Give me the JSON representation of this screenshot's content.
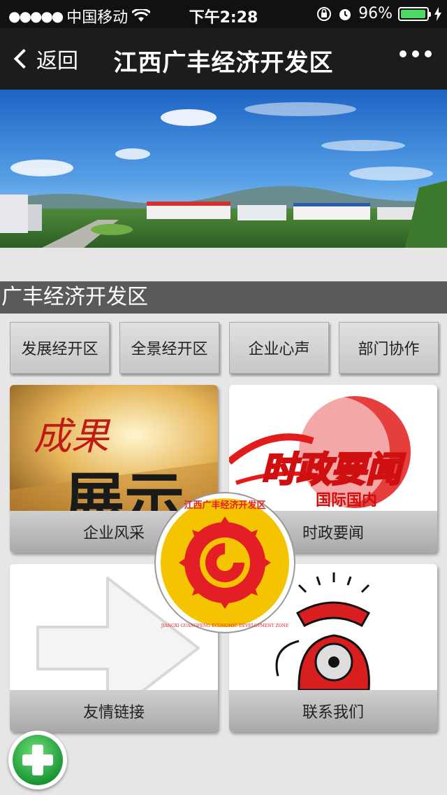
{
  "status_bar": {
    "carrier": "中国移动",
    "time": "下午2:28",
    "battery": "96%",
    "battery_level": 0.96
  },
  "nav": {
    "back_label": "返回",
    "title": "江西广丰经济开发区"
  },
  "section": {
    "title": "广丰经济开发区"
  },
  "tabs": [
    {
      "label": "发展经开区"
    },
    {
      "label": "全景经开区"
    },
    {
      "label": "企业心声"
    },
    {
      "label": "部门协作"
    }
  ],
  "tiles": [
    {
      "label": "企业风采",
      "art_text_1": "成果",
      "art_text_2": "展示"
    },
    {
      "label": "时政要闻",
      "art_text_1": "时政要闻",
      "art_text_2": "国际国内"
    },
    {
      "label": "友情链接"
    },
    {
      "label": "联系我们"
    }
  ],
  "emblem": {
    "text_cn": "江西广丰经济开发区",
    "text_en": "JIANGXI GUANGFENG ECONOMIC DEVELOPMENT ZONE"
  },
  "colors": {
    "nav_bg": "#1c1c1e",
    "section_bg": "#5a5a5a",
    "emblem_red": "#e31e24",
    "emblem_gold": "#f5c400",
    "fab_green": "#18a83a"
  }
}
